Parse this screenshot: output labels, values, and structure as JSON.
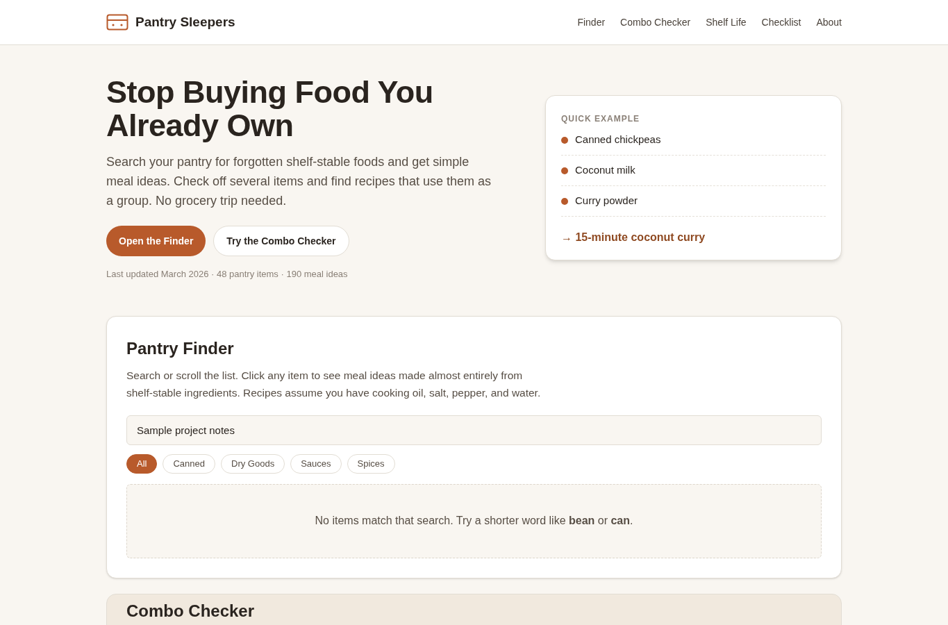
{
  "header": {
    "brand": "Pantry Sleepers",
    "nav": [
      "Finder",
      "Combo Checker",
      "Shelf Life",
      "Checklist",
      "About"
    ]
  },
  "hero": {
    "title": "Stop Buying Food You Already Own",
    "intro": "Search your pantry for forgotten shelf-stable foods and get simple meal ideas. Check off several items and find recipes that use them as a group. No grocery trip needed.",
    "buttons": [
      {
        "label": "Open the Finder",
        "kind": "primary"
      },
      {
        "label": "Try the Combo Checker",
        "kind": "secondary"
      }
    ],
    "meta": "Last updated March 2026 · 48 pantry items · 190 meal ideas"
  },
  "example": {
    "heading": "QUICK EXAMPLE",
    "items": [
      {
        "label": "Canned chickpeas",
        "color": "#b85a2b"
      },
      {
        "label": "Coconut milk",
        "color": "#b85a2b"
      },
      {
        "label": "Curry powder",
        "color": "#b85a2b"
      }
    ],
    "result": "→ 15-minute coconut curry"
  },
  "finder": {
    "title": "Pantry Finder",
    "description": "Search or scroll the list. Click any item to see meal ideas made almost entirely from shelf-stable ingredients. Recipes assume you have cooking oil, salt, pepper, and water.",
    "search_value": "Sample project notes",
    "filters": [
      {
        "label": "All",
        "selected": true
      },
      {
        "label": "Canned",
        "selected": false
      },
      {
        "label": "Dry Goods",
        "selected": false
      },
      {
        "label": "Sauces",
        "selected": false
      },
      {
        "label": "Spices",
        "selected": false
      }
    ],
    "empty_message": "No items match that search. Try a shorter word like **bean** or **can**."
  },
  "combo": {
    "title": "Combo Checker"
  }
}
